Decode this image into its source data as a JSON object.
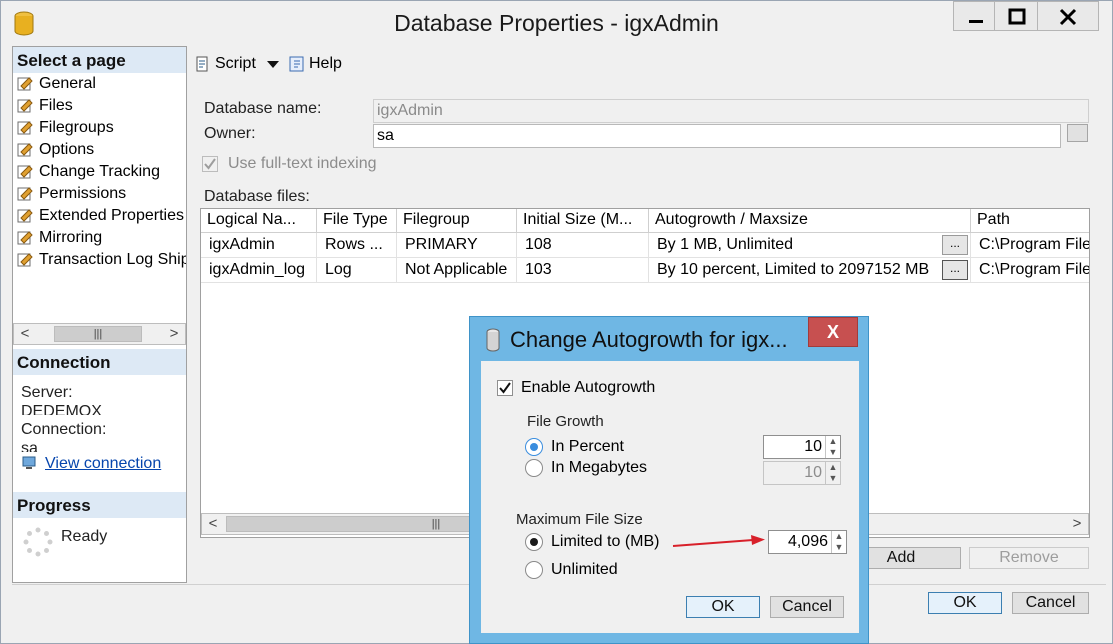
{
  "window": {
    "title": "Database Properties - igxAdmin",
    "buttons": {
      "minimize": "—",
      "maximize": "☐",
      "close": "X"
    }
  },
  "sidebar": {
    "select_page_header": "Select a page",
    "pages": [
      {
        "label": "General"
      },
      {
        "label": "Files"
      },
      {
        "label": "Filegroups"
      },
      {
        "label": "Options"
      },
      {
        "label": "Change Tracking"
      },
      {
        "label": "Permissions"
      },
      {
        "label": "Extended Properties"
      },
      {
        "label": "Mirroring"
      },
      {
        "label": "Transaction Log Shipping"
      }
    ],
    "connection_header": "Connection",
    "server_label": "Server:",
    "server_value": "DEDEMOX",
    "connection_label": "Connection:",
    "connection_value": "sa",
    "view_connection_link": "View connection",
    "progress_header": "Progress",
    "progress_status": "Ready"
  },
  "toolbar": {
    "script_label": "Script",
    "help_label": "Help"
  },
  "form": {
    "database_name_label": "Database name:",
    "database_name_value": "igxAdmin",
    "owner_label": "Owner:",
    "owner_value": "sa",
    "fulltext_label": "Use full-text indexing",
    "fulltext_checked": true,
    "database_files_label": "Database files:"
  },
  "files_grid": {
    "columns": [
      "Logical Na...",
      "File Type",
      "Filegroup",
      "Initial Size (M...",
      "Autogrowth / Maxsize",
      "Path"
    ],
    "rows": [
      {
        "logical_name": "igxAdmin",
        "file_type": "Rows ...",
        "filegroup": "PRIMARY",
        "initial_size": "108",
        "autogrowth": "By 1 MB, Unlimited",
        "path": "C:\\Program Files"
      },
      {
        "logical_name": "igxAdmin_log",
        "file_type": "Log",
        "filegroup": "Not Applicable",
        "initial_size": "103",
        "autogrowth": "By 10 percent, Limited to 2097152 MB",
        "path": "C:\\Program Files"
      }
    ],
    "ellipsis": "..."
  },
  "grid_buttons": {
    "add": "Add",
    "remove": "Remove"
  },
  "footer": {
    "ok": "OK",
    "cancel": "Cancel"
  },
  "dialog": {
    "title": "Change Autogrowth for igx...",
    "close": "X",
    "enable_autogrowth_label": "Enable Autogrowth",
    "enable_autogrowth_checked": true,
    "file_growth_label": "File Growth",
    "in_percent_label": "In Percent",
    "in_percent_value": "10",
    "in_megabytes_label": "In Megabytes",
    "in_megabytes_value": "10",
    "max_file_size_label": "Maximum File Size",
    "limited_to_label": "Limited to (MB)",
    "limited_to_value": "4,096",
    "unlimited_label": "Unlimited",
    "ok": "OK",
    "cancel": "Cancel"
  },
  "colors": {
    "dialog_frame": "#6fb7e4",
    "close_red": "#c75050",
    "annotation_arrow": "#d8202a",
    "link": "#0645ad"
  }
}
